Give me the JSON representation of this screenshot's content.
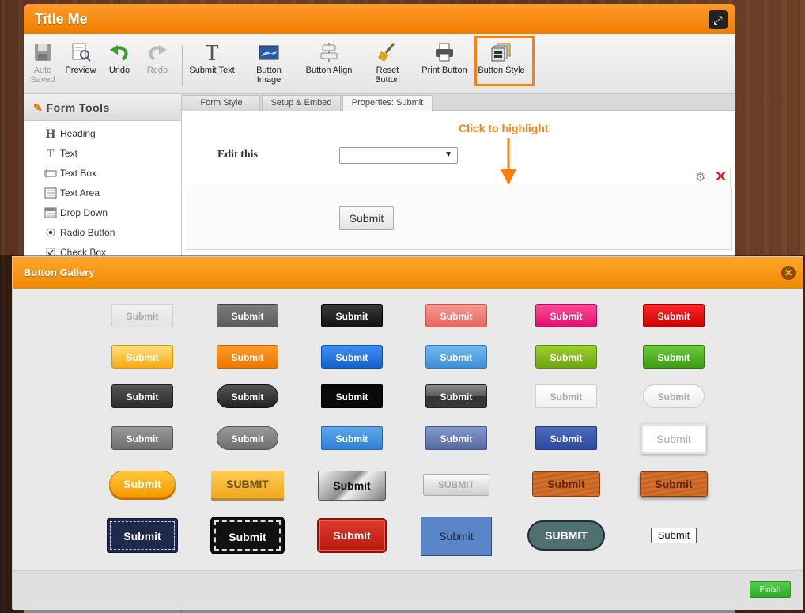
{
  "app": {
    "title": "Title Me"
  },
  "toolbar": {
    "auto_saved": "Auto Saved",
    "preview": "Preview",
    "undo": "Undo",
    "redo": "Redo",
    "submit_text": "Submit Text",
    "button_image": "Button Image",
    "button_align": "Button Align",
    "reset_button": "Reset Button",
    "print_button": "Print Button",
    "button_style": "Button Style"
  },
  "sidebar": {
    "title": "Form Tools",
    "items": [
      {
        "label": "Heading",
        "icon": "heading-icon"
      },
      {
        "label": "Text",
        "icon": "text-icon"
      },
      {
        "label": "Text Box",
        "icon": "textbox-icon"
      },
      {
        "label": "Text Area",
        "icon": "textarea-icon"
      },
      {
        "label": "Drop Down",
        "icon": "dropdown-icon"
      },
      {
        "label": "Radio Button",
        "icon": "radio-icon"
      },
      {
        "label": "Check Box",
        "icon": "checkbox-icon"
      }
    ]
  },
  "tabs": [
    "Form Style",
    "Setup & Embed",
    "Properties: Submit"
  ],
  "form": {
    "edit_label": "Edit this",
    "hint": "Click to highlight",
    "submit_label": "Submit"
  },
  "gallery": {
    "title": "Button Gallery",
    "finish": "Finish",
    "buttons": [
      "Submit",
      "Submit",
      "Submit",
      "Submit",
      "Submit",
      "Submit",
      "Submit",
      "Submit",
      "Submit",
      "Submit",
      "Submit",
      "Submit",
      "Submit",
      "Submit",
      "Submit",
      "Submit",
      "Submit",
      "Submit",
      "Submit",
      "Submit",
      "Submit",
      "Submit",
      "Submit",
      "Submit",
      "Submit",
      "SUBMIT",
      "Submit",
      "SUBMIT",
      "Submit",
      "Submit",
      "Submit",
      "Submit",
      "Submit",
      "Submit",
      "SUBMIT",
      "Submit"
    ]
  },
  "colors": {
    "accent": "#f08800",
    "finish": "#3dbb37",
    "highlight": "#ff7f0a"
  }
}
